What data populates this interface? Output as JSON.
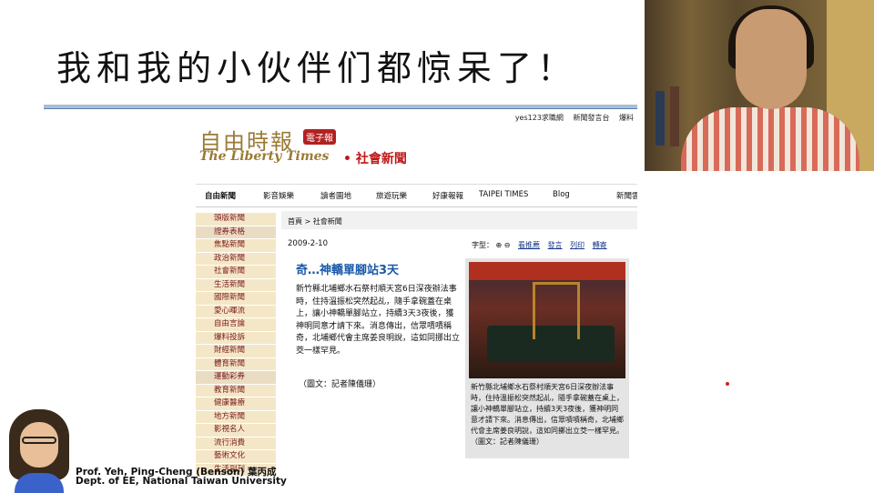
{
  "slide": {
    "title": "我和我的小伙伴们都惊呆了！",
    "presenter_line1": "Prof. Yeh, Ping-Cheng (Benson) 葉丙成",
    "presenter_line2": "Dept. of EE,  National Taiwan University"
  },
  "site": {
    "top_links": [
      "yes123求職網",
      "新聞發言台",
      "爆料"
    ],
    "logo_cn": "自由時報",
    "logo_badge": "電子報",
    "logo_en": "The Liberty Times",
    "section": "• 社會新聞",
    "nav": [
      "自由新聞",
      "影音娛樂",
      "讀者園地",
      "旅遊玩樂",
      "好康報報",
      "TAIPEI TIMES",
      "Blog",
      "新聞雲"
    ],
    "sidebar": [
      "頭版新聞",
      "證券表格",
      "焦點新聞",
      "政治新聞",
      "社會新聞",
      "生活新聞",
      "國際新聞",
      "愛心暉流",
      "自由言論",
      "爆料投訴",
      "財經新聞",
      "體育新聞",
      "運動彩券",
      "教育新聞",
      "健康醫療",
      "地方新聞",
      "影視名人",
      "流行消費",
      "藝術文化",
      "生活副刊"
    ]
  },
  "article": {
    "breadcrumb": "首頁 > 社會新聞",
    "date": "2009-2-10",
    "font_label": "字型：",
    "tools": [
      "看推薦",
      "發言",
      "列印",
      "轉寄"
    ],
    "headline": "奇…神轎單腳站3天",
    "body": "新竹縣北埔鄉水石祭村順天宮6日深夜辦法事時，住持溫振松突然起乩，隨手拿碗蓋在桌上，讓小神轎單腳站立，持續3天3夜後，獲神明同意才請下來。消息傳出，信眾嘖嘖稱奇，北埔鄉代會主席姜良明說，這如同挪出立茭一樣罕見。",
    "credit": "（圖文：記者陳儀珊）",
    "caption": "新竹縣北埔鄉水石祭村順天宮6日深夜辦法事時，住持溫振松突然起乩，隨手拿碗蓋在桌上，讓小神轎單腳站立，持續3天3夜後，獲神明同意才請下來。消息傳出，信眾嘖嘖稱奇，北埔鄉代會主席姜良明說，這如同擲出立茭一樣罕見。",
    "caption_credit": "（圖文：記者陳儀珊）"
  }
}
